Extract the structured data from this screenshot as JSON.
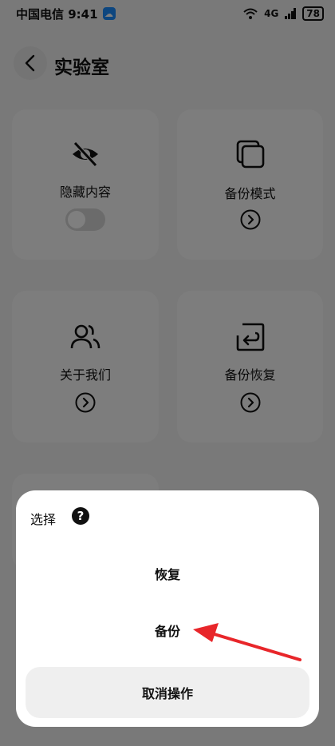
{
  "statusbar": {
    "carrier_time": "中国电信 9:41",
    "app_badge": "●",
    "network": "4G",
    "battery": "78"
  },
  "header": {
    "title": "实验室"
  },
  "cards": {
    "hide_content": {
      "label": "隐藏内容",
      "toggle_on": false
    },
    "backup_mode": {
      "label": "备份模式"
    },
    "about_us": {
      "label": "关于我们"
    },
    "backup_restore": {
      "label": "备份恢复"
    }
  },
  "dialog": {
    "title": "选择",
    "help_glyph": "?",
    "options": [
      "恢复",
      "备份"
    ],
    "cancel_label": "取消操作"
  },
  "colors": {
    "overlay": "#000000",
    "annotation_arrow": "#e8262a"
  }
}
